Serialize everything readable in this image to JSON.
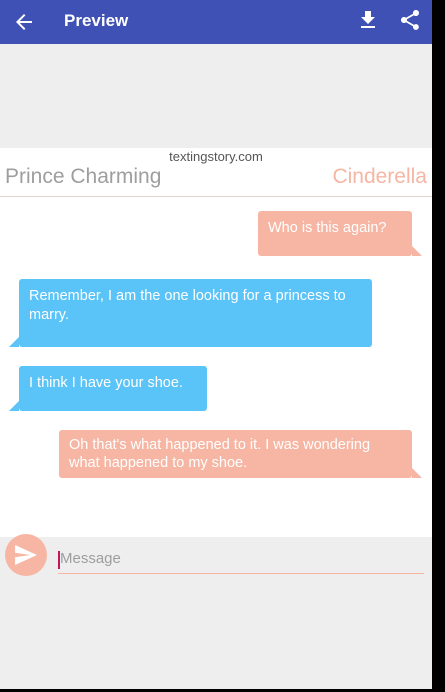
{
  "appbar": {
    "title": "Preview",
    "icons": [
      "back-arrow-icon",
      "download-icon",
      "share-icon"
    ],
    "color": "#3f51b5"
  },
  "story": {
    "watermark": "textingstory.com",
    "left_name": "Prince Charming",
    "right_name": "Cinderella",
    "left_color": "#5ac3f8",
    "right_color": "#f6b6a3"
  },
  "messages": [
    {
      "side": "right",
      "text": "Who is this again?"
    },
    {
      "side": "left",
      "text": "Remember, I am the one looking for a princess to marry."
    },
    {
      "side": "left",
      "text": "I think I have your shoe."
    },
    {
      "side": "right",
      "text": "Oh that's what happened to it. I was wondering what happened to my shoe."
    }
  ],
  "composer": {
    "placeholder": "Message",
    "send_icon": "send-icon"
  }
}
